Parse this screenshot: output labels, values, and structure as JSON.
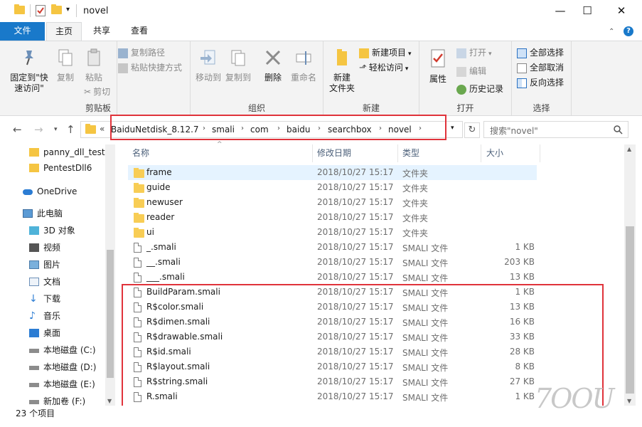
{
  "window": {
    "title": "novel",
    "controls": {
      "minimize": "—",
      "maximize": "☐",
      "close": "✕"
    }
  },
  "tabs": [
    {
      "label": "文件"
    },
    {
      "label": "主页"
    },
    {
      "label": "共享"
    },
    {
      "label": "查看"
    }
  ],
  "ribbon": {
    "clipboard": {
      "label": "剪贴板",
      "pin": "固定到\"快\n速访问\"",
      "copy": "复制",
      "paste": "粘贴",
      "copy_path": "复制路径",
      "paste_shortcut": "粘贴快捷方式",
      "cut": "剪切"
    },
    "organize": {
      "label": "组织",
      "move_to": "移动到",
      "copy_to": "复制到",
      "delete": "删除",
      "rename": "重命名"
    },
    "new": {
      "label": "新建",
      "new_folder": "新建\n文件夹",
      "new_item": "新建项目",
      "easy_access": "轻松访问"
    },
    "open": {
      "label": "打开",
      "properties": "属性",
      "open": "打开",
      "edit": "编辑",
      "history": "历史记录"
    },
    "select": {
      "label": "选择",
      "select_all": "全部选择",
      "select_none": "全部取消",
      "invert": "反向选择"
    }
  },
  "address": {
    "overflow": "«",
    "crumbs": [
      "BaiduNetdisk_8.12.7",
      "smali",
      "com",
      "baidu",
      "searchbox",
      "novel"
    ],
    "search_placeholder": "搜索\"novel\""
  },
  "nav": {
    "items": [
      {
        "label": "panny_dll_test",
        "icon": "folder-icon"
      },
      {
        "label": "PentestDll6",
        "icon": "folder-icon"
      },
      {
        "label": "OneDrive",
        "icon": "cloud-icon"
      },
      {
        "label": "此电脑",
        "icon": "computer-icon"
      },
      {
        "label": "3D 对象",
        "icon": "cube-icon"
      },
      {
        "label": "视频",
        "icon": "video-icon"
      },
      {
        "label": "图片",
        "icon": "picture-icon"
      },
      {
        "label": "文档",
        "icon": "document-icon"
      },
      {
        "label": "下载",
        "icon": "download-icon"
      },
      {
        "label": "音乐",
        "icon": "music-icon"
      },
      {
        "label": "桌面",
        "icon": "desktop-icon"
      },
      {
        "label": "本地磁盘 (C:)",
        "icon": "drive-icon"
      },
      {
        "label": "本地磁盘 (D:)",
        "icon": "drive-icon"
      },
      {
        "label": "本地磁盘 (E:)",
        "icon": "drive-icon"
      },
      {
        "label": "新加卷 (F:)",
        "icon": "drive-icon"
      }
    ]
  },
  "columns": {
    "name": "名称",
    "date": "修改日期",
    "type": "类型",
    "size": "大小"
  },
  "files": [
    {
      "name": "frame",
      "date": "2018/10/27 15:17",
      "type": "文件夹",
      "size": "",
      "kind": "folder"
    },
    {
      "name": "guide",
      "date": "2018/10/27 15:17",
      "type": "文件夹",
      "size": "",
      "kind": "folder"
    },
    {
      "name": "newuser",
      "date": "2018/10/27 15:17",
      "type": "文件夹",
      "size": "",
      "kind": "folder"
    },
    {
      "name": "reader",
      "date": "2018/10/27 15:17",
      "type": "文件夹",
      "size": "",
      "kind": "folder"
    },
    {
      "name": "ui",
      "date": "2018/10/27 15:17",
      "type": "文件夹",
      "size": "",
      "kind": "folder"
    },
    {
      "name": "_.smali",
      "date": "2018/10/27 15:17",
      "type": "SMALI 文件",
      "size": "1 KB",
      "kind": "file"
    },
    {
      "name": "__.smali",
      "date": "2018/10/27 15:17",
      "type": "SMALI 文件",
      "size": "203 KB",
      "kind": "file"
    },
    {
      "name": "___.smali",
      "date": "2018/10/27 15:17",
      "type": "SMALI 文件",
      "size": "13 KB",
      "kind": "file"
    },
    {
      "name": "BuildParam.smali",
      "date": "2018/10/27 15:17",
      "type": "SMALI 文件",
      "size": "1 KB",
      "kind": "file"
    },
    {
      "name": "R$color.smali",
      "date": "2018/10/27 15:17",
      "type": "SMALI 文件",
      "size": "13 KB",
      "kind": "file"
    },
    {
      "name": "R$dimen.smali",
      "date": "2018/10/27 15:17",
      "type": "SMALI 文件",
      "size": "16 KB",
      "kind": "file"
    },
    {
      "name": "R$drawable.smali",
      "date": "2018/10/27 15:17",
      "type": "SMALI 文件",
      "size": "33 KB",
      "kind": "file"
    },
    {
      "name": "R$id.smali",
      "date": "2018/10/27 15:17",
      "type": "SMALI 文件",
      "size": "28 KB",
      "kind": "file"
    },
    {
      "name": "R$layout.smali",
      "date": "2018/10/27 15:17",
      "type": "SMALI 文件",
      "size": "8 KB",
      "kind": "file"
    },
    {
      "name": "R$string.smali",
      "date": "2018/10/27 15:17",
      "type": "SMALI 文件",
      "size": "27 KB",
      "kind": "file"
    },
    {
      "name": "R.smali",
      "date": "2018/10/27 15:17",
      "type": "SMALI 文件",
      "size": "1 KB",
      "kind": "file"
    }
  ],
  "status": {
    "count": "23 个项目"
  },
  "watermark": "7OOU",
  "colors": {
    "accent": "#1979ca",
    "highlight": "#e0333b",
    "selected_row": "#e5f3ff"
  }
}
